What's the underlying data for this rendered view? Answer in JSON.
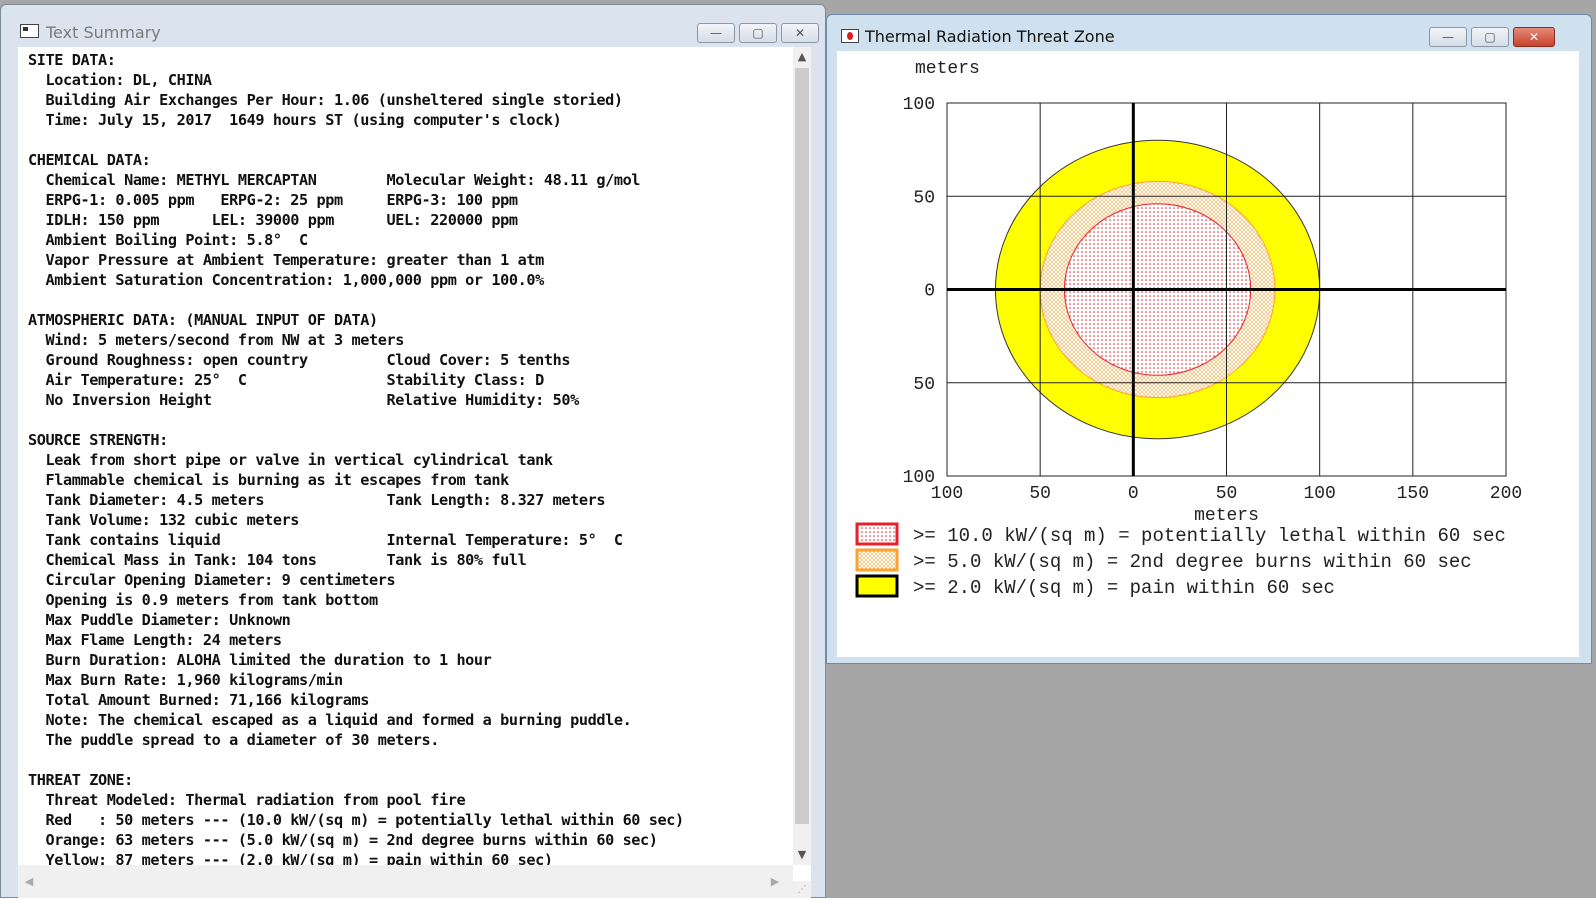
{
  "summary_window": {
    "title": "Text Summary",
    "minimize": "—",
    "maximize": "▢",
    "close": "✕",
    "lines": [
      "SITE DATA:",
      "  Location: DL, CHINA",
      "  Building Air Exchanges Per Hour: 1.06 (unsheltered single storied)",
      "  Time: July 15, 2017  1649 hours ST (using computer's clock)",
      "",
      "CHEMICAL DATA:",
      "  Chemical Name: METHYL MERCAPTAN        Molecular Weight: 48.11 g/mol",
      "  ERPG-1: 0.005 ppm   ERPG-2: 25 ppm     ERPG-3: 100 ppm",
      "  IDLH: 150 ppm      LEL: 39000 ppm      UEL: 220000 ppm",
      "  Ambient Boiling Point: 5.8°  C",
      "  Vapor Pressure at Ambient Temperature: greater than 1 atm",
      "  Ambient Saturation Concentration: 1,000,000 ppm or 100.0%",
      "",
      "ATMOSPHERIC DATA: (MANUAL INPUT OF DATA)",
      "  Wind: 5 meters/second from NW at 3 meters",
      "  Ground Roughness: open country         Cloud Cover: 5 tenths",
      "  Air Temperature: 25°  C                Stability Class: D",
      "  No Inversion Height                    Relative Humidity: 50%",
      "",
      "SOURCE STRENGTH:",
      "  Leak from short pipe or valve in vertical cylindrical tank",
      "  Flammable chemical is burning as it escapes from tank",
      "  Tank Diameter: 4.5 meters              Tank Length: 8.327 meters",
      "  Tank Volume: 132 cubic meters",
      "  Tank contains liquid                   Internal Temperature: 5°  C",
      "  Chemical Mass in Tank: 104 tons        Tank is 80% full",
      "  Circular Opening Diameter: 9 centimeters",
      "  Opening is 0.9 meters from tank bottom",
      "  Max Puddle Diameter: Unknown",
      "  Max Flame Length: 24 meters",
      "  Burn Duration: ALOHA limited the duration to 1 hour",
      "  Max Burn Rate: 1,960 kilograms/min",
      "  Total Amount Burned: 71,166 kilograms",
      "  Note: The chemical escaped as a liquid and formed a burning puddle.",
      "  The puddle spread to a diameter of 30 meters.",
      "",
      "THREAT ZONE:",
      "  Threat Modeled: Thermal radiation from pool fire",
      "  Red   : 50 meters --- (10.0 kW/(sq m) = potentially lethal within 60 sec)",
      "  Orange: 63 meters --- (5.0 kW/(sq m) = 2nd degree burns within 60 sec)",
      "  Yellow: 87 meters --- (2.0 kW/(sq m) = pain within 60 sec)"
    ]
  },
  "threat_window": {
    "title": "Thermal Radiation Threat Zone",
    "minimize": "—",
    "maximize": "▢",
    "close": "✕",
    "y_unit_label": "meters",
    "x_unit_label": "meters",
    "x_ticks": [
      "100",
      "50",
      "0",
      "50",
      "100",
      "150",
      "200"
    ],
    "y_ticks": [
      "100",
      "50",
      "0",
      "50",
      "100"
    ],
    "colors": {
      "red": "#e8202a",
      "orange": "#ffa030",
      "yellow": "#ffff00"
    },
    "zones": [
      {
        "name": "red",
        "radius_m": 50,
        "legend": ">= 10.0 kW/(sq m) = potentially lethal within 60 sec"
      },
      {
        "name": "orange",
        "radius_m": 63,
        "legend": ">= 5.0 kW/(sq m) = 2nd degree burns within 60 sec"
      },
      {
        "name": "yellow",
        "radius_m": 87,
        "legend": ">= 2.0 kW/(sq m) = pain within 60 sec"
      }
    ]
  }
}
